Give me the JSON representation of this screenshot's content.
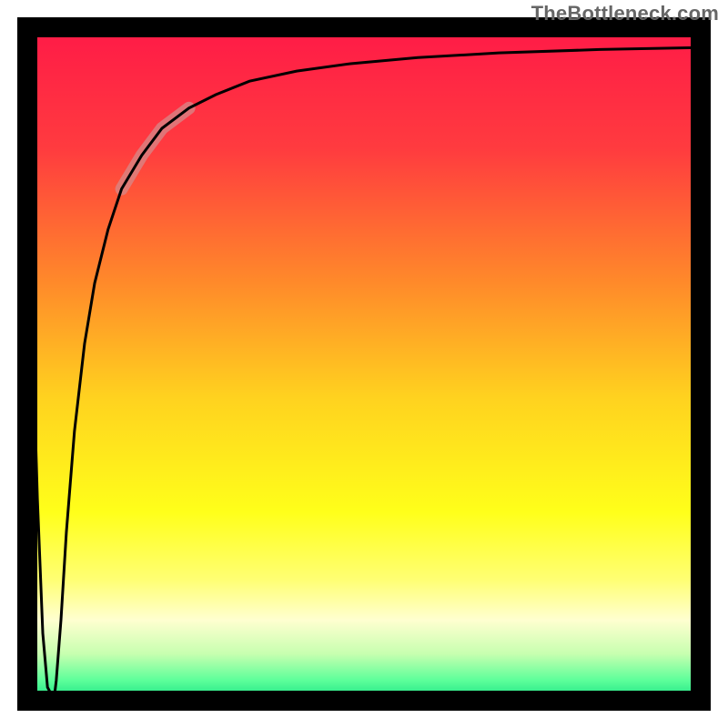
{
  "watermark": "TheBottleneck.com",
  "chart_data": {
    "type": "line",
    "title": "",
    "xlabel": "",
    "ylabel": "",
    "xlim": [
      0,
      100
    ],
    "ylim": [
      0,
      100
    ],
    "grid": false,
    "legend": false,
    "annotations": [],
    "background_gradient_stops": [
      {
        "offset": 0.0,
        "color": "#ff1a47"
      },
      {
        "offset": 0.18,
        "color": "#ff3b3f"
      },
      {
        "offset": 0.38,
        "color": "#ff8a2a"
      },
      {
        "offset": 0.55,
        "color": "#ffd21f"
      },
      {
        "offset": 0.72,
        "color": "#ffff1a"
      },
      {
        "offset": 0.82,
        "color": "#ffff73"
      },
      {
        "offset": 0.88,
        "color": "#ffffd0"
      },
      {
        "offset": 0.93,
        "color": "#c8ffb0"
      },
      {
        "offset": 0.97,
        "color": "#5cff9a"
      },
      {
        "offset": 1.0,
        "color": "#17e084"
      }
    ],
    "series": [
      {
        "name": "bottleneck-curve",
        "stroke": "#000000",
        "x": [
          0.0,
          0.6,
          1.5,
          2.3,
          3.0,
          3.8,
          4.0,
          4.3,
          5.0,
          5.8,
          7.0,
          8.5,
          10.0,
          12.0,
          14.0,
          17.0,
          20.0,
          24.0,
          28.0,
          33.0,
          40.0,
          48.0,
          58.0,
          70.0,
          85.0,
          100.0
        ],
        "values": [
          98.0,
          60.0,
          30.0,
          10.0,
          2.0,
          0.5,
          0.5,
          3.0,
          12.0,
          25.0,
          40.0,
          53.0,
          62.0,
          70.0,
          76.0,
          81.0,
          85.0,
          88.0,
          90.0,
          92.0,
          93.5,
          94.6,
          95.5,
          96.2,
          96.7,
          97.0
        ]
      },
      {
        "name": "highlight-segment",
        "stroke": "#d58a8a",
        "stroke_opacity": 0.75,
        "stroke_width": 14,
        "x": [
          14.0,
          17.0,
          20.0,
          24.0
        ],
        "values": [
          76.0,
          81.0,
          85.0,
          88.0
        ]
      }
    ],
    "frame": {
      "stroke": "#000000",
      "stroke_width": 22
    }
  }
}
